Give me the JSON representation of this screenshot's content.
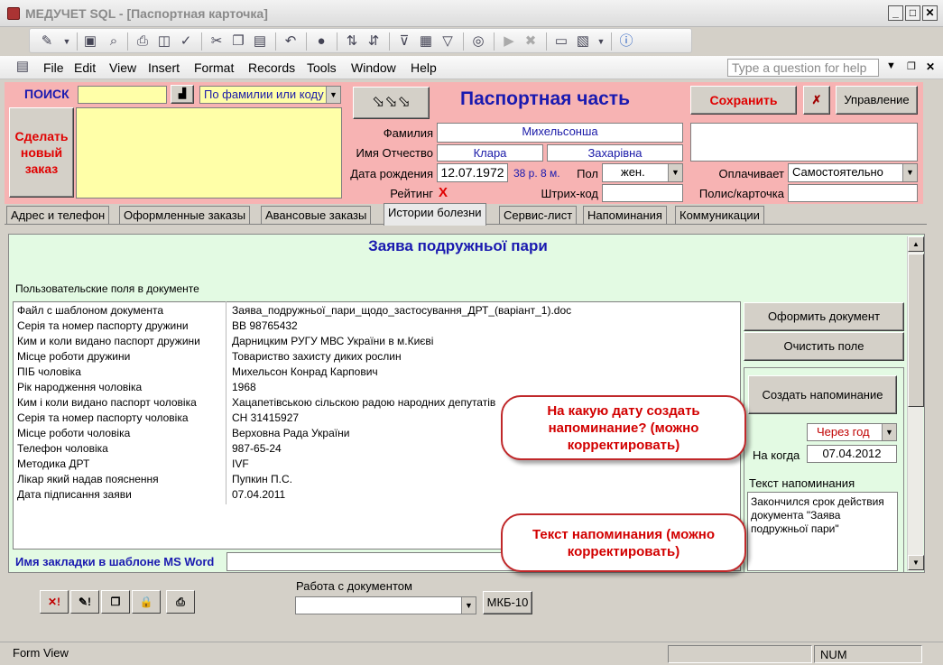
{
  "window": {
    "title": "МЕДУЧЕТ SQL - [Паспортная карточка]"
  },
  "menu": {
    "items": [
      "File",
      "Edit",
      "View",
      "Insert",
      "Format",
      "Records",
      "Tools",
      "Window",
      "Help"
    ],
    "help_placeholder": "Type a question for help"
  },
  "search": {
    "label": "ПОИСК",
    "value": "",
    "mode": "По фамилии или коду"
  },
  "new_order": {
    "label": "Сделать новый заказ"
  },
  "header": {
    "section_title": "Паспортная часть",
    "save": "Сохранить",
    "manage": "Управление",
    "surname_label": "Фамилия",
    "surname": "Михельсонша",
    "name_label": "Имя Отчество",
    "first_name": "Клара",
    "patronymic": "Захарівна",
    "dob_label": "Дата рождения",
    "dob": "12.07.1972",
    "age": "38 р. 8 м.",
    "sex_label": "Пол",
    "sex": "жен.",
    "payer_label": "Оплачивает",
    "payer": "Самостоятельно",
    "rating_label": "Рейтинг",
    "rating": "X",
    "barcode_label": "Штрих-код",
    "barcode": "",
    "policy_label": "Полис/карточка",
    "policy": ""
  },
  "tabs": [
    {
      "label": "Адрес и телефон"
    },
    {
      "label": "Оформленные заказы"
    },
    {
      "label": "Авансовые заказы"
    },
    {
      "label": "Истории болезни"
    },
    {
      "label": "Сервис-лист"
    },
    {
      "label": "Напоминания"
    },
    {
      "label": "Коммуникации"
    }
  ],
  "document": {
    "title": "Заява подружньої пари",
    "fields_caption": "Пользовательские поля в документе",
    "rows": [
      {
        "k": "Файл с шаблоном документа",
        "v": "Заява_подружньої_пари_щодо_застосування_ДРТ_(варіант_1).doc"
      },
      {
        "k": "Серія та номер паспорту дружини",
        "v": "ВВ 98765432"
      },
      {
        "k": "Ким и коли видано паспорт дружини",
        "v": "Дарницким РУГУ МВС України в м.Києві"
      },
      {
        "k": "Місце роботи дружини",
        "v": "Товариство захисту диких рослин"
      },
      {
        "k": "ПІБ чоловіка",
        "v": "Михельсон Конрад Карпович"
      },
      {
        "k": "Рік народження чоловіка",
        "v": "1968"
      },
      {
        "k": "Ким і коли видано паспорт чоловіка",
        "v": "Хацапетівською сільскою радою народних депутатів"
      },
      {
        "k": "Серія та номер паспорту чоловіка",
        "v": "СН 31415927"
      },
      {
        "k": "Місце роботи чоловіка",
        "v": "Верховна Рада України"
      },
      {
        "k": "Телефон чоловіка",
        "v": "987-65-24"
      },
      {
        "k": "Методика ДРТ",
        "v": "IVF"
      },
      {
        "k": "Лікар який надав пояснення",
        "v": "Пупкин П.С."
      },
      {
        "k": "Дата підписання заяви",
        "v": "07.04.2011"
      }
    ],
    "bookmark_label": "Имя закладки в шаблоне MS Word",
    "bookmark_value": "",
    "btn_make": "Оформить документ",
    "btn_clear": "Очистить поле",
    "btn_reminder": "Создать напоминание",
    "reminder_period": "Через год",
    "when_label": "На когда",
    "when_value": "07.04.2012",
    "reminder_text_label": "Текст напоминания",
    "reminder_text": "Закончился срок действия документа \"Заява подружньої пари\""
  },
  "callouts": {
    "date": "На какую дату создать напоминание? (можно корректировать)",
    "text": "Текст напоминания (можно корректировать)"
  },
  "bottom": {
    "work_label": "Работа с документом",
    "work_value": "",
    "mkb": "МКБ-10"
  },
  "status": {
    "mode": "Form View",
    "num": "NUM"
  }
}
